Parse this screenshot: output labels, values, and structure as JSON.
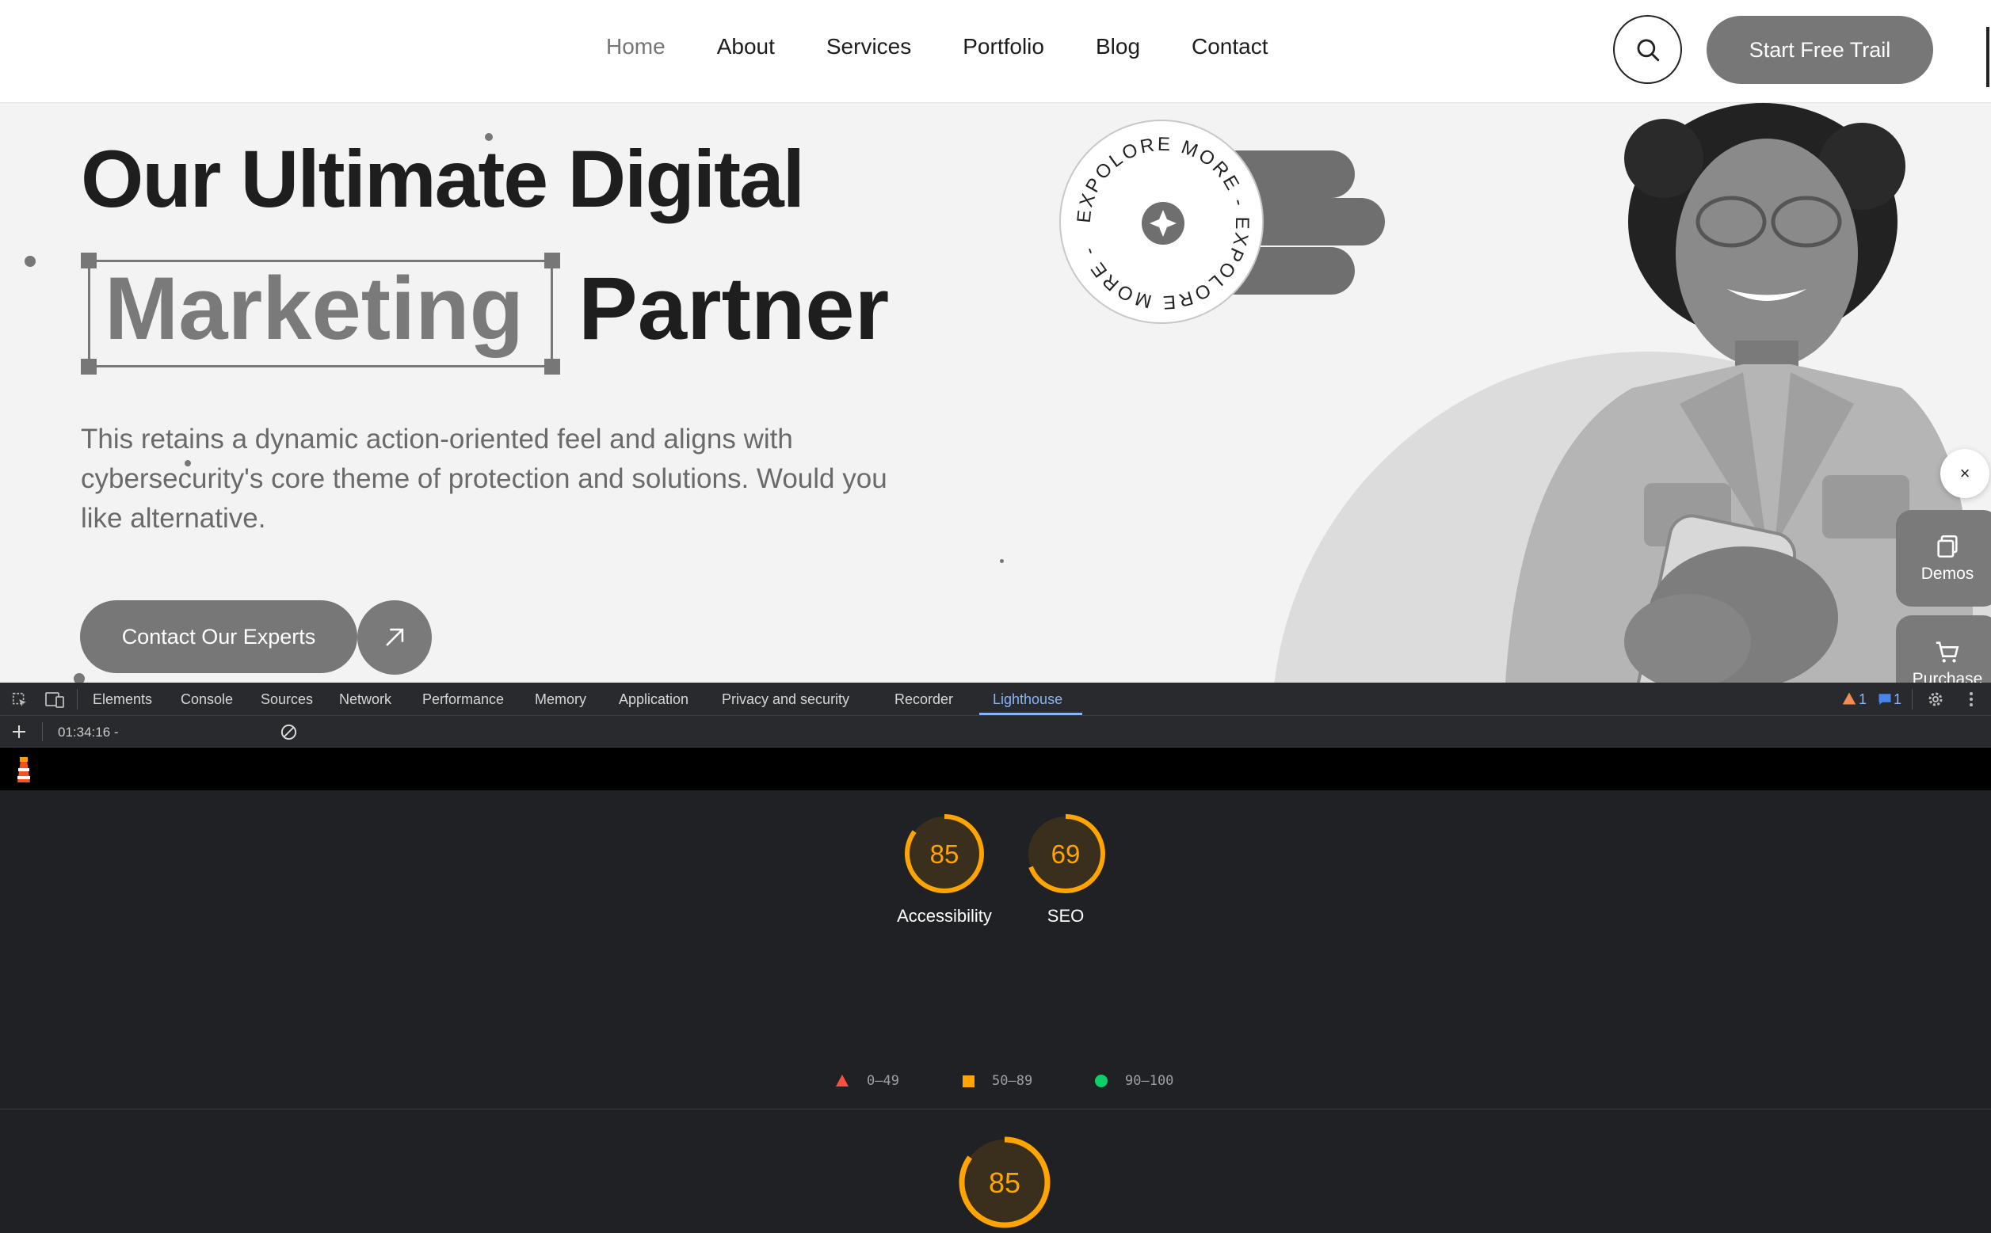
{
  "header": {
    "nav": [
      "Home",
      "About",
      "Services",
      "Portfolio",
      "Blog",
      "Contact"
    ],
    "active_nav": "Home",
    "cta": "Start Free Trail"
  },
  "hero": {
    "line1": "Our Ultimate Digital",
    "highlight": "Marketing",
    "line2_rest": "Partner",
    "description": "This retains a dynamic action-oriented feel and aligns with cybersecurity's core theme of protection and solutions. Would you like alternative.",
    "contact_button": "Contact Our Experts",
    "badge_text": "EXPOLORE MORE - EXPOLORE MORE -"
  },
  "side_widgets": {
    "close": "×",
    "demos": "Demos",
    "purchase": "Purchase"
  },
  "devtools": {
    "tabs": [
      "Elements",
      "Console",
      "Sources",
      "Network",
      "Performance",
      "Memory",
      "Application",
      "Privacy and security",
      "Recorder",
      "Lighthouse"
    ],
    "active_tab": "Lighthouse",
    "warnings": "1",
    "messages": "1",
    "timestamp": "01:34:16 -",
    "scores": [
      {
        "label": "Accessibility",
        "value": 85
      },
      {
        "label": "SEO",
        "value": 69
      }
    ],
    "legend": [
      "0–49",
      "50–89",
      "90–100"
    ],
    "bottom_score": 85,
    "colors": {
      "average": "#ffa400",
      "fail": "#ff4e42",
      "pass": "#0cce6b",
      "accent": "#8ab4f8"
    }
  }
}
